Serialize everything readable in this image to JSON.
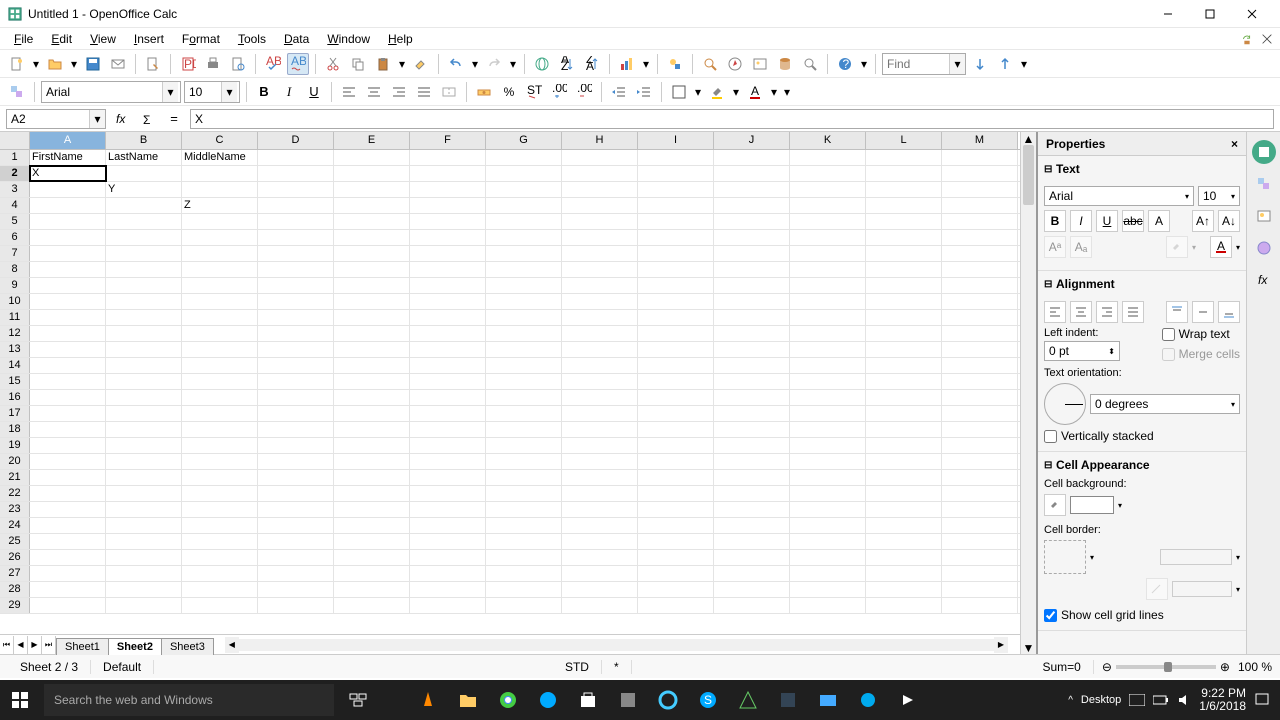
{
  "window": {
    "title": "Untitled 1 - OpenOffice Calc"
  },
  "menu": {
    "items": [
      "File",
      "Edit",
      "View",
      "Insert",
      "Format",
      "Tools",
      "Data",
      "Window",
      "Help"
    ]
  },
  "find": {
    "placeholder": "Find"
  },
  "format": {
    "font": "Arial",
    "size": "10"
  },
  "namebox": {
    "value": "A2"
  },
  "formula": {
    "value": "X"
  },
  "columns": [
    "A",
    "B",
    "C",
    "D",
    "E",
    "F",
    "G",
    "H",
    "I",
    "J",
    "K",
    "L",
    "M"
  ],
  "active_col": "A",
  "rows_count": 29,
  "active_row": 2,
  "cells": {
    "A1": "FirstName",
    "B1": "LastName",
    "C1": "MiddleName",
    "A2": "X",
    "B3": "Y",
    "C4": "Z"
  },
  "tabs": {
    "items": [
      "Sheet1",
      "Sheet2",
      "Sheet3"
    ],
    "active": "Sheet2"
  },
  "status": {
    "sheet": "Sheet 2 / 3",
    "style": "Default",
    "mode": "STD",
    "modified": "*",
    "sum": "Sum=0",
    "zoom": "100 %"
  },
  "panel": {
    "title": "Properties",
    "text": {
      "header": "Text",
      "font": "Arial",
      "size": "10"
    },
    "alignment": {
      "header": "Alignment",
      "left_indent_label": "Left indent:",
      "left_indent": "0 pt",
      "wrap_label": "Wrap text",
      "merge_label": "Merge cells",
      "orientation_label": "Text orientation:",
      "orientation": "0 degrees",
      "vertical_label": "Vertically stacked"
    },
    "appearance": {
      "header": "Cell Appearance",
      "bg_label": "Cell background:",
      "border_label": "Cell border:",
      "gridlines_label": "Show cell grid lines"
    }
  },
  "taskbar": {
    "search_placeholder": "Search the web and Windows",
    "desktop_label": "Desktop",
    "time": "9:22 PM",
    "date": "1/6/2018"
  }
}
